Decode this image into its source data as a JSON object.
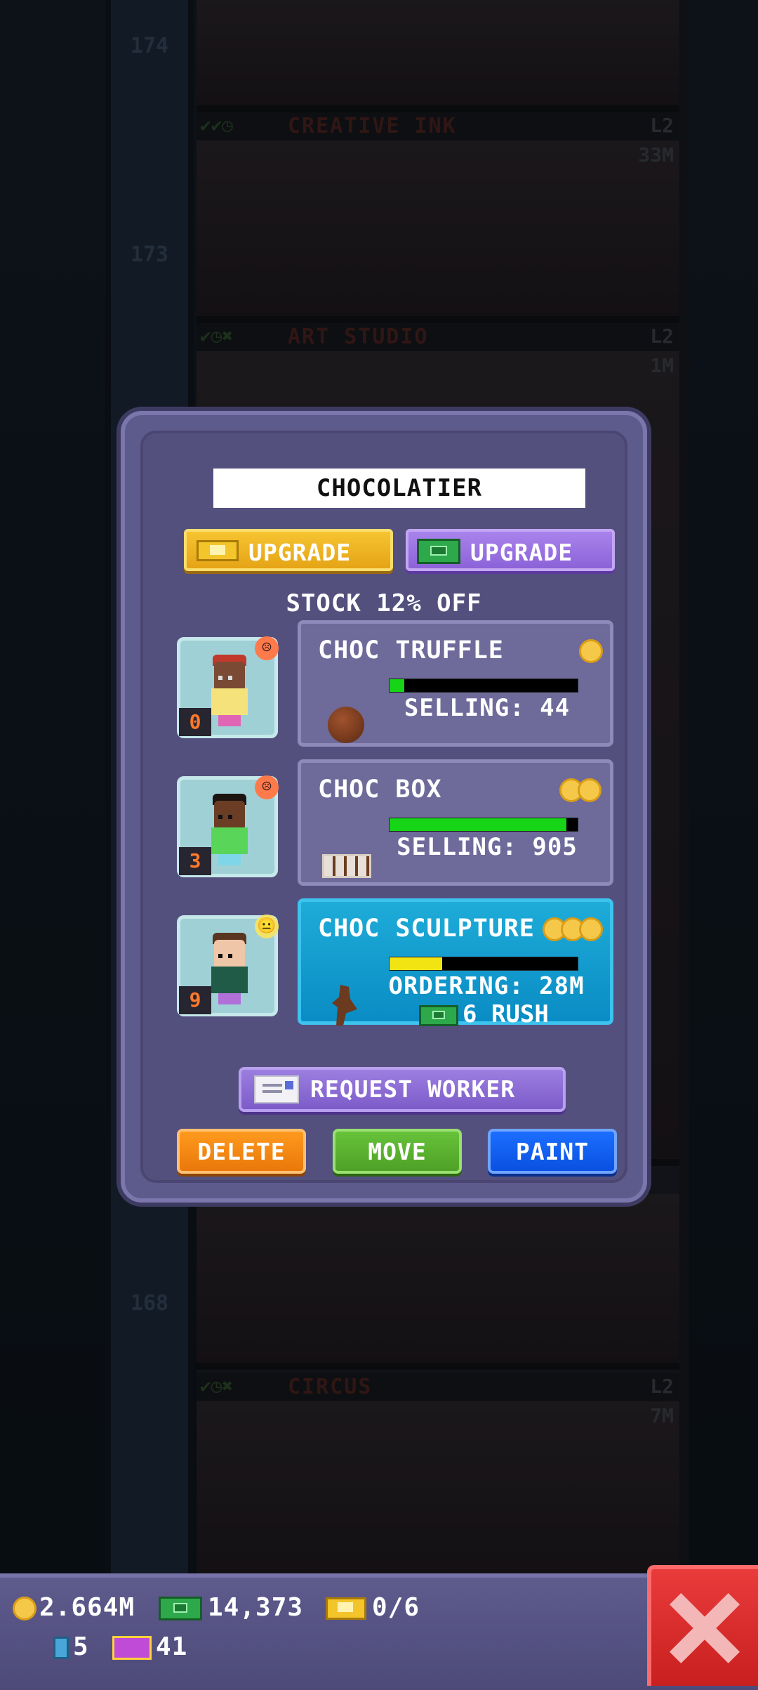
{
  "background": {
    "floor_numbers": [
      "174",
      "173",
      "168"
    ],
    "floors": [
      {
        "name": "CREATIVE INK",
        "level": "L2",
        "value": "33M"
      },
      {
        "name": "ART STUDIO",
        "level": "L2",
        "value": "1M"
      },
      {
        "name": "CIRCUS",
        "level": "L2",
        "value": "7M"
      }
    ]
  },
  "dialog": {
    "title": "CHOCOLATIER",
    "upgrade_coins_label": "UPGRADE",
    "upgrade_bux_label": "UPGRADE",
    "stock_text": "STOCK 12% OFF",
    "rows": [
      {
        "worker_level": "0",
        "worker_mood": "unhappy",
        "product": "CHOC TRUFFLE",
        "coins": 1,
        "progress": 0.08,
        "bar_color": "#16d416",
        "status": "SELLING: 44",
        "active": false
      },
      {
        "worker_level": "3",
        "worker_mood": "unhappy",
        "product": "CHOC BOX",
        "coins": 2,
        "progress": 0.94,
        "bar_color": "#16d416",
        "status": "SELLING: 905",
        "active": false
      },
      {
        "worker_level": "9",
        "worker_mood": "neutral",
        "product": "CHOC SCULPTURE",
        "coins": 3,
        "progress": 0.28,
        "bar_color": "#f2e313",
        "status": "ORDERING: 28M",
        "rush": "6 RUSH",
        "active": true
      }
    ],
    "request_worker_label": "REQUEST WORKER",
    "delete_label": "DELETE",
    "move_label": "MOVE",
    "paint_label": "PAINT"
  },
  "status_bar": {
    "coins": "2.664M",
    "bux": "14,373",
    "tickets": "0/6",
    "keys": "5",
    "vip": "41"
  },
  "colors": {
    "dialog_bg": "#54507e",
    "active_product": "#0a8cc4",
    "delete": "#e9780a",
    "move": "#4ea126",
    "paint": "#0a51e0",
    "close": "#c81f1f"
  }
}
